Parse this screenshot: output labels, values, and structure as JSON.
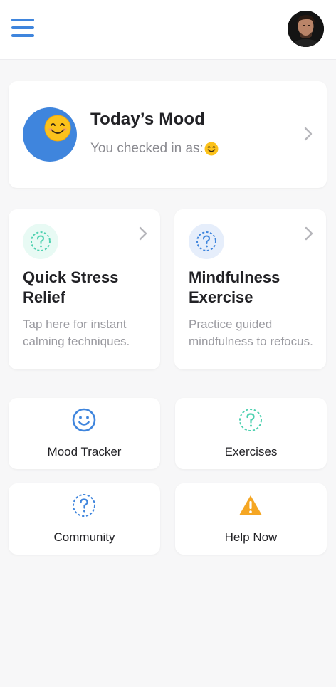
{
  "header": {
    "menu_icon": "hamburger-menu-icon",
    "avatar_icon": "user-avatar"
  },
  "mood": {
    "title": "Today’s Mood",
    "subtitle": "You checked in as:",
    "emoji": "smiling-face-emoji",
    "accent": "#3f85dd"
  },
  "features": [
    {
      "title": "Quick Stress Relief",
      "description": "Tap here for instant calming techniques.",
      "icon": "help-circle-icon",
      "icon_color": "#4fd1b0",
      "icon_bg": "#e8faf4"
    },
    {
      "title": "Mindfulness Exercise",
      "description": "Practice guided mindfulness to refocus.",
      "icon": "help-circle-icon",
      "icon_color": "#3f85dd",
      "icon_bg": "#e6eefb"
    }
  ],
  "tiles": [
    {
      "label": "Mood Tracker",
      "icon": "smile-icon",
      "color": "#3f85dd"
    },
    {
      "label": "Exercises",
      "icon": "help-circle-icon",
      "color": "#4fd1b0"
    },
    {
      "label": "Community",
      "icon": "help-circle-icon",
      "color": "#3f85dd"
    },
    {
      "label": "Help Now",
      "icon": "warning-icon",
      "color": "#f5a623"
    }
  ]
}
